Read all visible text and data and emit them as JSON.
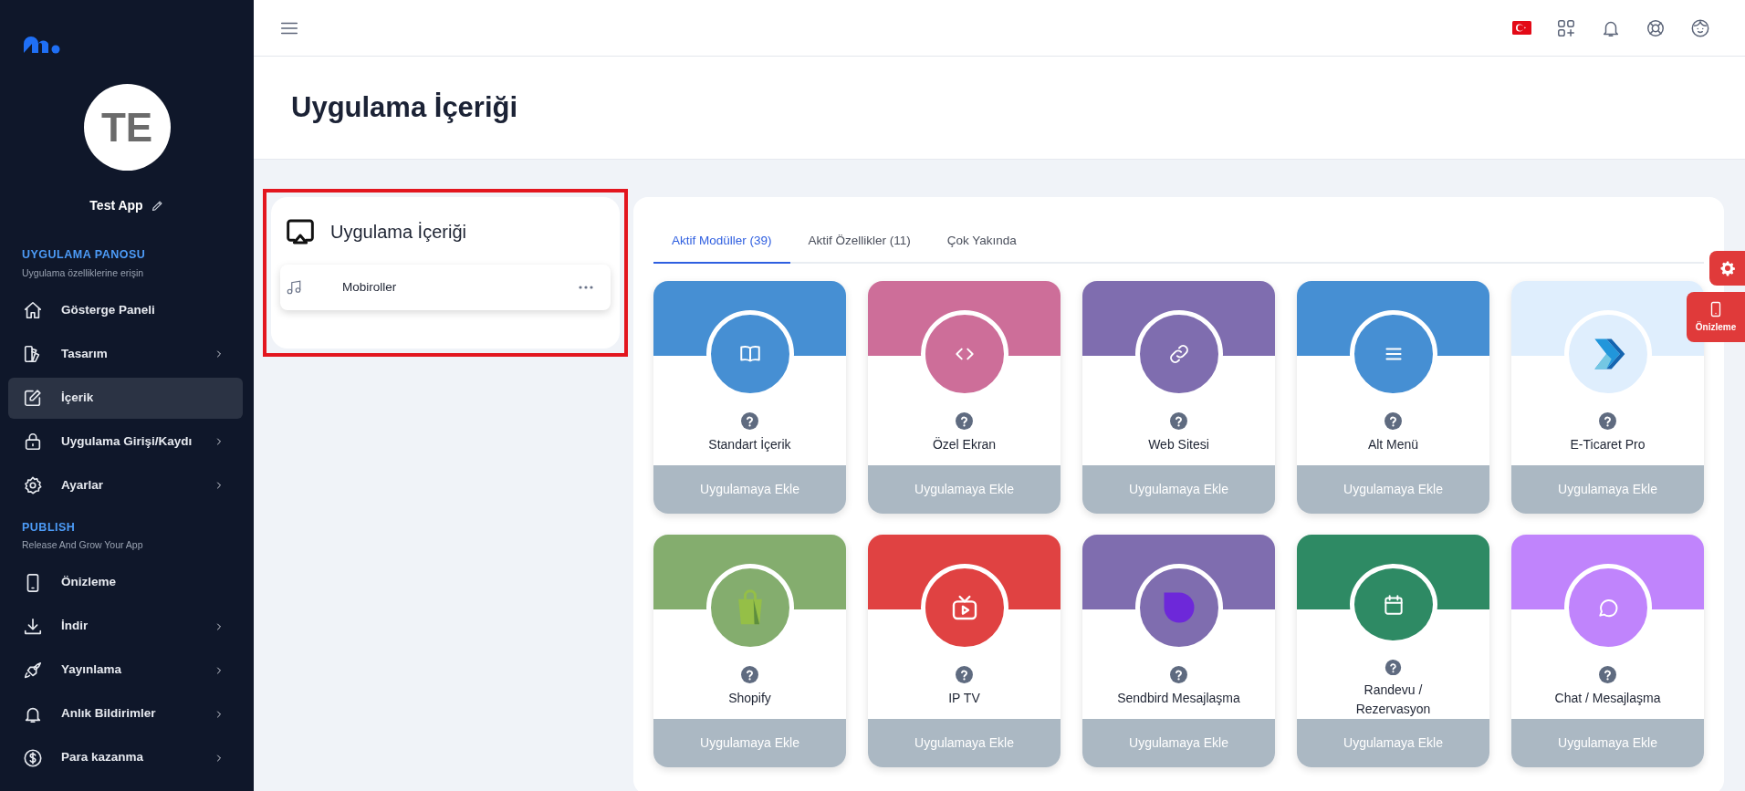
{
  "sidebar": {
    "avatar_initials": "TE",
    "app_name": "Test App",
    "sections": [
      {
        "title": "UYGULAMA PANOSU",
        "subtitle": "Uygulama özelliklerine erişin",
        "items": [
          {
            "label": "Gösterge Paneli",
            "submenu": false,
            "selected": false
          },
          {
            "label": "Tasarım",
            "submenu": true,
            "selected": false
          },
          {
            "label": "İçerik",
            "submenu": false,
            "selected": true
          },
          {
            "label": "Uygulama Girişi/Kaydı",
            "submenu": true,
            "selected": false
          },
          {
            "label": "Ayarlar",
            "submenu": true,
            "selected": false
          }
        ]
      },
      {
        "title": "PUBLISH",
        "subtitle": "Release And Grow Your App",
        "items": [
          {
            "label": "Önizleme",
            "submenu": false,
            "selected": false
          },
          {
            "label": "İndir",
            "submenu": true,
            "selected": false
          },
          {
            "label": "Yayınlama",
            "submenu": true,
            "selected": false
          },
          {
            "label": "Anlık Bildirimler",
            "submenu": true,
            "selected": false
          },
          {
            "label": "Para kazanma",
            "submenu": true,
            "selected": false
          }
        ]
      }
    ]
  },
  "page_title": "Uygulama İçeriği",
  "content_panel": {
    "title": "Uygulama İçeriği",
    "items": [
      {
        "label": "Mobiroller"
      }
    ]
  },
  "tabs": [
    {
      "label": "Aktif Modüller (39)",
      "selected": true
    },
    {
      "label": "Aktif Özellikler (11)",
      "selected": false
    },
    {
      "label": "Çok Yakında",
      "selected": false
    }
  ],
  "modules": [
    {
      "name": "Standart İçerik",
      "color": "#468fd3",
      "button": "Uygulamaya Ekle"
    },
    {
      "name": "Özel Ekran",
      "color": "#cd6e99",
      "button": "Uygulamaya Ekle"
    },
    {
      "name": "Web Sitesi",
      "color": "#7f6daf",
      "button": "Uygulamaya Ekle"
    },
    {
      "name": "Alt Menü",
      "color": "#468fd3",
      "button": "Uygulamaya Ekle"
    },
    {
      "name": "E-Ticaret Pro",
      "color": "#dfeefd",
      "button": "Uygulamaya Ekle"
    },
    {
      "name": "Shopify",
      "color": "#84ad6e",
      "button": "Uygulamaya Ekle"
    },
    {
      "name": "IP TV",
      "color": "#e04242",
      "button": "Uygulamaya Ekle"
    },
    {
      "name": "Sendbird Mesajlaşma",
      "color": "#7f6daf",
      "button": "Uygulamaya Ekle"
    },
    {
      "name": "Randevu / Rezervasyon",
      "color": "#2e8a64",
      "button": "Uygulamaya Ekle"
    },
    {
      "name": "Chat / Mesajlaşma",
      "color": "#c084fc",
      "button": "Uygulamaya Ekle"
    }
  ],
  "floating_preview": {
    "label": "Önizleme"
  }
}
